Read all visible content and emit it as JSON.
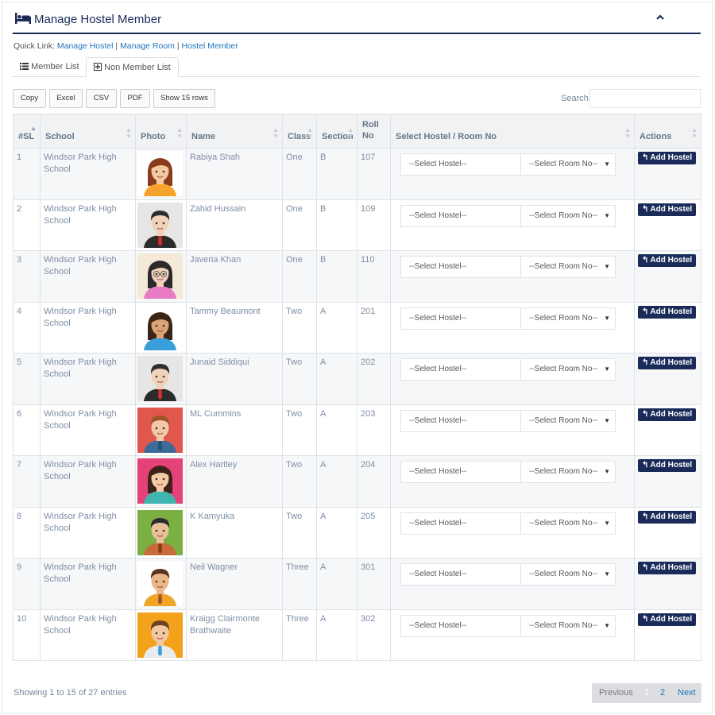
{
  "header": {
    "title": "Manage Hostel Member",
    "icon": "bed-icon"
  },
  "quick_link": {
    "label": "Quick Link:",
    "links": [
      "Manage Hostel",
      "Manage Room",
      "Hostel Member"
    ],
    "separator": "|"
  },
  "tabs": [
    {
      "label": "Member List",
      "icon": "list-icon"
    },
    {
      "label": "Non Member List",
      "icon": "plus-square-icon",
      "active": true
    }
  ],
  "toolbar": {
    "copy": "Copy",
    "excel": "Excel",
    "csv": "CSV",
    "pdf": "PDF",
    "show_rows": "Show 15 rows",
    "search_label": "Search:",
    "search_value": ""
  },
  "columns": [
    "#SL",
    "School",
    "Photo",
    "Name",
    "Class",
    "Section",
    "Roll No",
    "Select Hostel / Room No",
    "Actions"
  ],
  "rows": [
    {
      "sl": "1",
      "school": "Windsor Park High School",
      "name": "Rabiya Shah",
      "class": "One",
      "section": "B",
      "roll": "107",
      "avatar": "female-avatar-brown-hair"
    },
    {
      "sl": "2",
      "school": "Windsor Park High School",
      "name": "Zahid Hussain",
      "class": "One",
      "section": "B",
      "roll": "109",
      "avatar": "male-avatar-suit"
    },
    {
      "sl": "3",
      "school": "Windsor Park High School",
      "name": "Javeria Khan",
      "class": "One",
      "section": "B",
      "roll": "110",
      "avatar": "female-avatar-glasses"
    },
    {
      "sl": "4",
      "school": "Windsor Park High School",
      "name": "Tammy Beaumont",
      "class": "Two",
      "section": "A",
      "roll": "201",
      "avatar": "female-avatar-blue"
    },
    {
      "sl": "5",
      "school": "Windsor Park High School",
      "name": "Junaid Siddiqui",
      "class": "Two",
      "section": "A",
      "roll": "202",
      "avatar": "male-avatar-suit"
    },
    {
      "sl": "6",
      "school": "Windsor Park High School",
      "name": "ML Cummins",
      "class": "Two",
      "section": "A",
      "roll": "203",
      "avatar": "male-avatar-red-bg"
    },
    {
      "sl": "7",
      "school": "Windsor Park High School",
      "name": "Alex Hartley",
      "class": "Two",
      "section": "A",
      "roll": "204",
      "avatar": "female-avatar-pink-bg"
    },
    {
      "sl": "8",
      "school": "Windsor Park High School",
      "name": "K Kamyuka",
      "class": "Two",
      "section": "A",
      "roll": "205",
      "avatar": "male-avatar-green-bg"
    },
    {
      "sl": "9",
      "school": "Windsor Park High School",
      "name": "Neil Wagner",
      "class": "Three",
      "section": "A",
      "roll": "301",
      "avatar": "male-avatar-orange"
    },
    {
      "sl": "10",
      "school": "Windsor Park High School",
      "name": "Kraigg Clairmonte Brathwaite",
      "class": "Three",
      "section": "A",
      "roll": "302",
      "avatar": "male-avatar-orange-bg"
    }
  ],
  "select_hostel_placeholder": "--Select Hostel--",
  "select_room_placeholder": "--Select Room No--",
  "add_hostel_label": "Add Hostel",
  "footer": {
    "info": "Showing 1 to 15 of 27 entries",
    "previous": "Previous",
    "pages": [
      "1",
      "2"
    ],
    "current_page": "1",
    "next": "Next"
  },
  "colors": {
    "primary": "#1a2b59",
    "link": "#1e73be",
    "text": "#73879c"
  }
}
